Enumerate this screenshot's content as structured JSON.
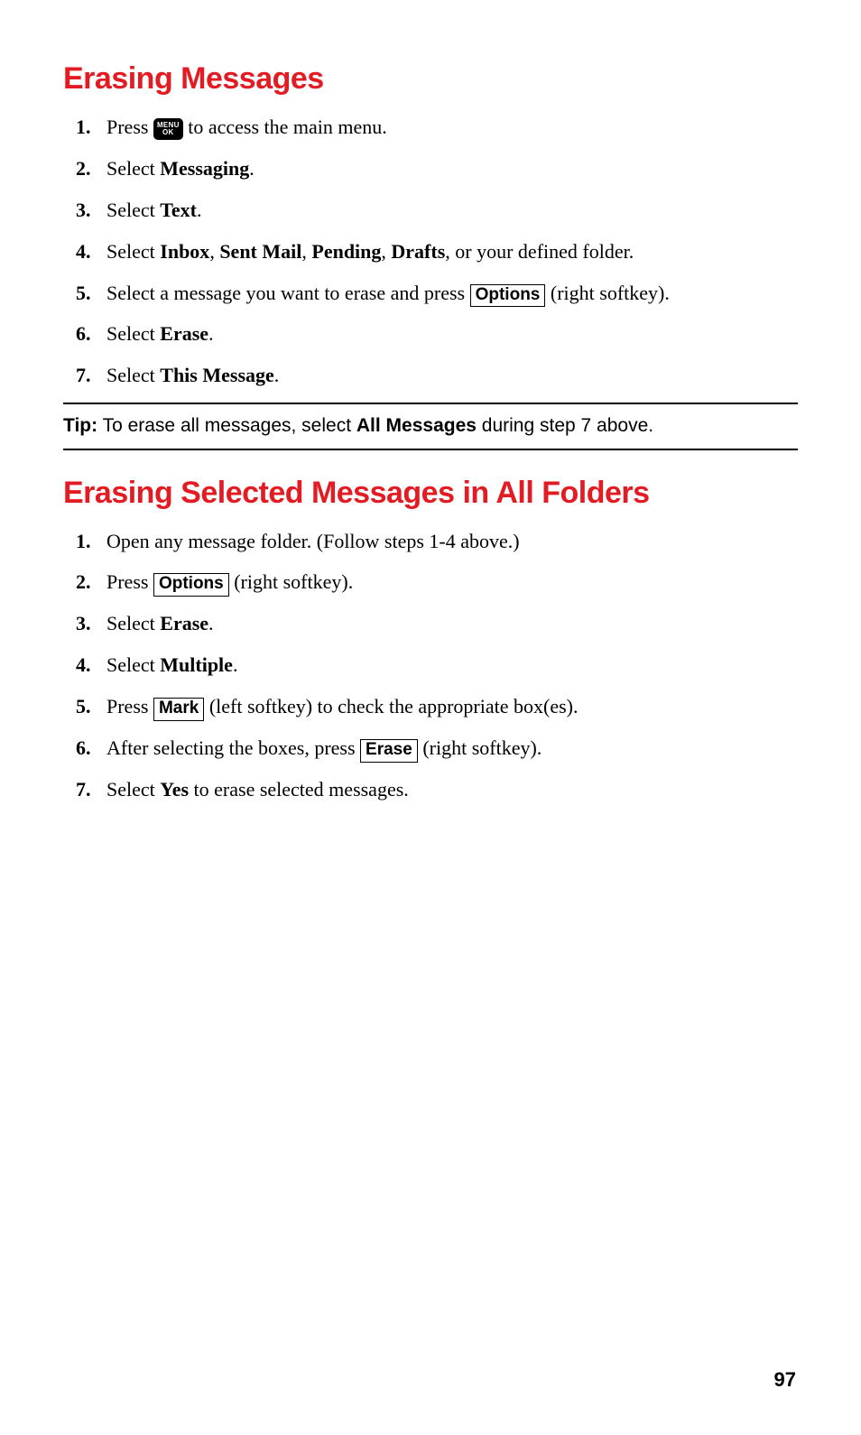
{
  "section1": {
    "title": "Erasing Messages",
    "steps": {
      "s1_num": "1.",
      "s1_a": "Press ",
      "s1_key_top": "MENU",
      "s1_key_bot": "OK",
      "s1_b": " to access the main menu.",
      "s2_num": "2.",
      "s2_a": "Select ",
      "s2_b": "Messaging",
      "s2_c": ".",
      "s3_num": "3.",
      "s3_a": "Select ",
      "s3_b": "Text",
      "s3_c": ".",
      "s4_num": "4.",
      "s4_a": "Select ",
      "s4_b": "Inbox",
      "s4_c": ", ",
      "s4_d": "Sent Mail",
      "s4_e": ", ",
      "s4_f": "Pending",
      "s4_g": ", ",
      "s4_h": "Drafts",
      "s4_i": ", or your defined folder.",
      "s5_num": "5.",
      "s5_a": "Select a message you want to erase and press ",
      "s5_box": "Options",
      "s5_b": " (right softkey).",
      "s6_num": "6.",
      "s6_a": "Select ",
      "s6_b": "Erase",
      "s6_c": ".",
      "s7_num": "7.",
      "s7_a": "Select ",
      "s7_b": "This Message",
      "s7_c": "."
    }
  },
  "tip": {
    "label": "Tip:",
    "a": " To erase all messages, select ",
    "b": "All Messages",
    "c": " during step 7 above."
  },
  "section2": {
    "title": "Erasing Selected Messages in All Folders",
    "steps": {
      "s1_num": "1.",
      "s1_a": "Open any message folder. (Follow steps 1-4 above.)",
      "s2_num": "2.",
      "s2_a": "Press ",
      "s2_box": "Options",
      "s2_b": " (right softkey).",
      "s3_num": "3.",
      "s3_a": "Select ",
      "s3_b": "Erase",
      "s3_c": ".",
      "s4_num": "4.",
      "s4_a": "Select ",
      "s4_b": "Multiple",
      "s4_c": ".",
      "s5_num": "5.",
      "s5_a": "Press ",
      "s5_box": "Mark",
      "s5_b": " (left softkey) to check the appropriate box(es).",
      "s6_num": "6.",
      "s6_a": "After selecting the boxes, press ",
      "s6_box": "Erase",
      "s6_b": " (right softkey).",
      "s7_num": "7.",
      "s7_a": "Select ",
      "s7_b": "Yes",
      "s7_c": " to erase selected messages."
    }
  },
  "page_number": "97"
}
